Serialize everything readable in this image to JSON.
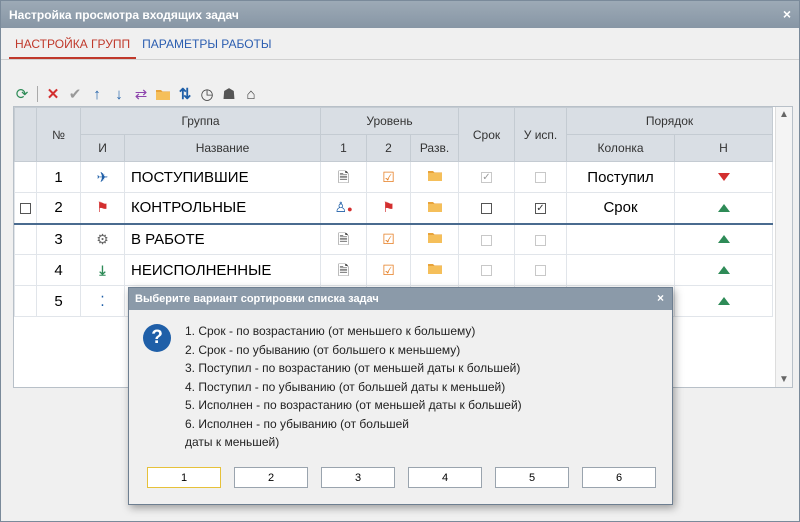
{
  "window": {
    "title": "Настройка просмотра входящих задач",
    "close_glyph": "×"
  },
  "tabs": [
    {
      "label": "НАСТРОЙКА ГРУПП",
      "active": true
    },
    {
      "label": "ПАРАМЕТРЫ РАБОТЫ",
      "active": false
    }
  ],
  "toolbar": [
    "refresh-icon",
    "delete-icon",
    "check-icon",
    "arrow-up-icon",
    "arrow-down-icon",
    "sync-icon",
    "folder-icon",
    "sort-icon",
    "clock-icon",
    "users-icon",
    "home-icon"
  ],
  "grid": {
    "headers": {
      "num": "№",
      "group": "Группа",
      "level": "Уровень",
      "deadline": "Срок",
      "executor": "У исп.",
      "order": "Порядок",
      "icon": "И",
      "name": "Название",
      "l1": "1",
      "l2": "2",
      "expand": "Разв.",
      "column": "Колонка",
      "direction": "Н"
    },
    "rows": [
      {
        "num": "1",
        "name": "ПОСТУПИВШИЕ",
        "column": "Поступил",
        "dir": "down"
      },
      {
        "num": "2",
        "name": "КОНТРОЛЬНЫЕ",
        "column": "Срок",
        "dir": "up"
      },
      {
        "num": "3",
        "name": "В РАБОТЕ",
        "column": "",
        "dir": "up"
      },
      {
        "num": "4",
        "name": "НЕИСПОЛНЕННЫЕ",
        "column": "",
        "dir": "up"
      },
      {
        "num": "5",
        "name": "",
        "column": "",
        "dir": "up"
      }
    ]
  },
  "dialog": {
    "title": "Выберите вариант сортировки списка задач",
    "close_glyph": "×",
    "icon_glyph": "?",
    "lines": [
      "1. Срок - по возрастанию (от меньшего к большему)",
      "2. Срок - по убыванию (от большего к меньшему)",
      "3. Поступил - по возрастанию (от меньшей даты к большей)",
      "4. Поступил - по убыванию (от большей даты к меньшей)",
      "5. Исполнен - по возрастанию (от меньшей даты к большей)",
      "6. Исполнен - по убыванию (от большей",
      "даты к меньшей)"
    ],
    "buttons": [
      "1",
      "2",
      "3",
      "4",
      "5",
      "6"
    ]
  }
}
